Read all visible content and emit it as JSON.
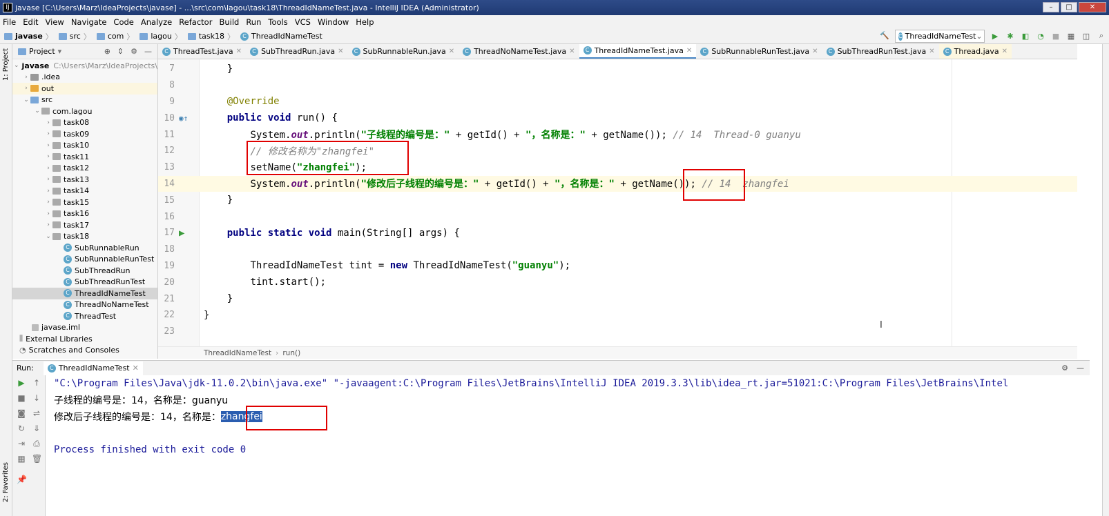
{
  "window": {
    "title": "javase [C:\\Users\\Marz\\IdeaProjects\\javase] - ...\\src\\com\\lagou\\task18\\ThreadIdNameTest.java - IntelliJ IDEA (Administrator)",
    "logo": "IJ"
  },
  "menu": [
    "File",
    "Edit",
    "View",
    "Navigate",
    "Code",
    "Analyze",
    "Refactor",
    "Build",
    "Run",
    "Tools",
    "VCS",
    "Window",
    "Help"
  ],
  "breadcrumbs": [
    "javase",
    "src",
    "com",
    "lagou",
    "task18",
    "ThreadIdNameTest"
  ],
  "run_config": "ThreadIdNameTest",
  "left_tool": {
    "project": "1: Project",
    "favorites": "2: Favorites"
  },
  "project_panel": {
    "title": "Project",
    "root": "javase",
    "root_path": "C:\\Users\\Marz\\IdeaProjects\\javase",
    "items": [
      {
        "label": ".idea"
      },
      {
        "label": "out"
      },
      {
        "label": "src"
      },
      {
        "label": "com.lagou"
      },
      {
        "label": "task08"
      },
      {
        "label": "task09"
      },
      {
        "label": "task10"
      },
      {
        "label": "task11"
      },
      {
        "label": "task12"
      },
      {
        "label": "task13"
      },
      {
        "label": "task14"
      },
      {
        "label": "task15"
      },
      {
        "label": "task16"
      },
      {
        "label": "task17"
      },
      {
        "label": "task18"
      },
      {
        "label": "SubRunnableRun"
      },
      {
        "label": "SubRunnableRunTest"
      },
      {
        "label": "SubThreadRun"
      },
      {
        "label": "SubThreadRunTest"
      },
      {
        "label": "ThreadIdNameTest"
      },
      {
        "label": "ThreadNoNameTest"
      },
      {
        "label": "ThreadTest"
      },
      {
        "label": "javase.iml"
      },
      {
        "label": "External Libraries"
      },
      {
        "label": "Scratches and Consoles"
      }
    ]
  },
  "tabs": [
    "ThreadTest.java",
    "SubThreadRun.java",
    "SubRunnableRun.java",
    "ThreadNoNameTest.java",
    "ThreadIdNameTest.java",
    "SubRunnableRunTest.java",
    "SubThreadRunTest.java",
    "Thread.java"
  ],
  "editor": {
    "line_numbers": [
      "7",
      "8",
      "9",
      "10",
      "11",
      "12",
      "13",
      "14",
      "15",
      "16",
      "17",
      "18",
      "19",
      "20",
      "21",
      "22",
      "23"
    ],
    "code": {
      "l7": "}",
      "l9": "@Override",
      "l10_kw": "public void",
      "l10_rest": " run() {",
      "l11_a": "System.",
      "l11_out": "out",
      "l11_b": ".println(",
      "l11_s1": "\"子线程的编号是：\"",
      "l11_c": " + getId() + ",
      "l11_s2": "\"，名称是：\"",
      "l11_d": " + getName()); ",
      "l11_cm": "// 14  Thread-0 guanyu",
      "l12_cm": "// 修改名称为\"zhangfei\"",
      "l13_a": "setName(",
      "l13_s": "\"zhangfei\"",
      "l13_b": ");",
      "l14_a": "System.",
      "l14_out": "out",
      "l14_b": ".println(",
      "l14_s1": "\"修改后子线程的编号是：\"",
      "l14_c": " + getId() + ",
      "l14_s2": "\"，名称是：\"",
      "l14_d": " + getName()); ",
      "l14_cm": "// 14  zhangfei",
      "l15": "}",
      "l17_kw": "public static void",
      "l17_rest": " main(String[] args) {",
      "l19_a": "ThreadIdNameTest tint = ",
      "l19_kw": "new",
      "l19_b": " ThreadIdNameTest(",
      "l19_s": "\"guanyu\"",
      "l19_c": ");",
      "l20": "tint.start();",
      "l21": "}",
      "l22": "}"
    },
    "breadcrumb": [
      "ThreadIdNameTest",
      "run()"
    ]
  },
  "run_panel": {
    "label": "Run:",
    "tab": "ThreadIdNameTest",
    "lines": {
      "cmd": "\"C:\\Program Files\\Java\\jdk-11.0.2\\bin\\java.exe\" \"-javaagent:C:\\Program Files\\JetBrains\\IntelliJ IDEA 2019.3.3\\lib\\idea_rt.jar=51021:C:\\Program Files\\JetBrains\\Intel",
      "out1": "子线程的编号是：14，名称是：guanyu",
      "out2_prefix": "修改后子线程的编号是：14，名称是：",
      "out2_sel": "zhangfei",
      "exit": "Process finished with exit code 0"
    }
  },
  "colors": {
    "accent": "#4a88c7",
    "highlight_box": "#e00000",
    "selection": "#2a5db0"
  }
}
